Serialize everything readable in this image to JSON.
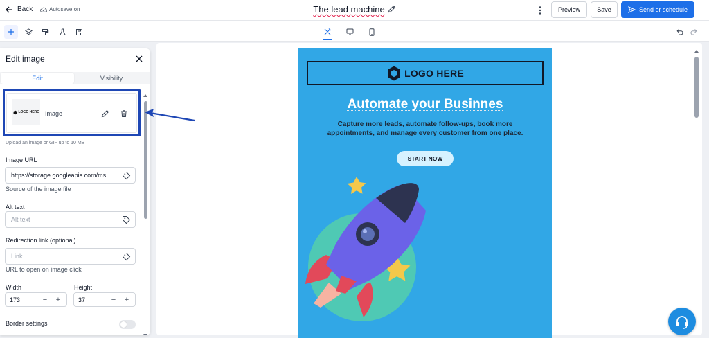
{
  "header": {
    "back_label": "Back",
    "autosave_label": "Autosave on",
    "title": "The lead machine",
    "preview_label": "Preview",
    "save_label": "Save",
    "send_label": "Send or schedule"
  },
  "toolbar": {
    "left_tools": [
      "plus-icon",
      "layers-icon",
      "paint-roller-icon",
      "flask-icon",
      "save-template-icon"
    ],
    "device_tools": [
      "design-tools-icon",
      "desktop-icon",
      "mobile-icon"
    ],
    "history_tools": [
      "undo-icon",
      "redo-icon"
    ]
  },
  "panel": {
    "title": "Edit image",
    "tabs": [
      {
        "label": "Edit",
        "active": true
      },
      {
        "label": "Visibility",
        "active": false
      }
    ],
    "image_card": {
      "thumb_text": "LOGO HERE",
      "label": "Image"
    },
    "upload_hint": "Upload an image or GIF up to 10 MB",
    "image_url": {
      "label": "Image URL",
      "value": "https://storage.googleapis.com/ms",
      "hint": "Source of the image file"
    },
    "alt_text": {
      "label": "Alt text",
      "placeholder": "Alt text"
    },
    "redirect": {
      "label": "Redirection link (optional)",
      "placeholder": "Link",
      "hint": "URL to open on image click"
    },
    "width": {
      "label": "Width",
      "value": "173"
    },
    "height": {
      "label": "Height",
      "value": "37"
    },
    "border": {
      "label": "Border settings",
      "enabled": false
    }
  },
  "email": {
    "logo_text": "LOGO HERE",
    "headline": "Automate your Businnes",
    "subtext": "Capture more leads, automate follow-ups, book more appointments, and manage every customer from one place.",
    "cta_label": "START NOW",
    "background": "#31a7e6"
  },
  "colors": {
    "accent": "#1d6fe8",
    "highlight_border": "#1e47b5"
  }
}
